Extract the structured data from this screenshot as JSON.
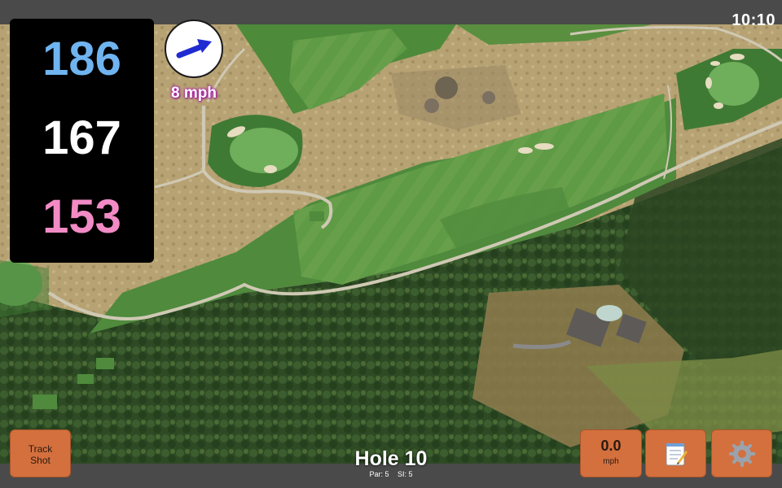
{
  "status": {
    "time": "10:10"
  },
  "distances": {
    "back": "186",
    "center": "167",
    "front": "153"
  },
  "wind": {
    "speed_label": "8 mph",
    "direction": "east-northeast"
  },
  "hole": {
    "title": "Hole 10",
    "par": "Par: 5",
    "stroke_index": "SI: 5"
  },
  "buttons": {
    "track_shot": "Track\nShot",
    "wind_value": "0.0",
    "wind_unit": "mph",
    "notes_icon": "notepad-icon",
    "settings_icon": "gear-icon"
  },
  "colors": {
    "back_distance": "#6fb4f0",
    "center_distance": "#ffffff",
    "front_distance": "#f28bc5",
    "button_fill": "#d4703d",
    "wind_arrow": "#1f2bd1"
  }
}
